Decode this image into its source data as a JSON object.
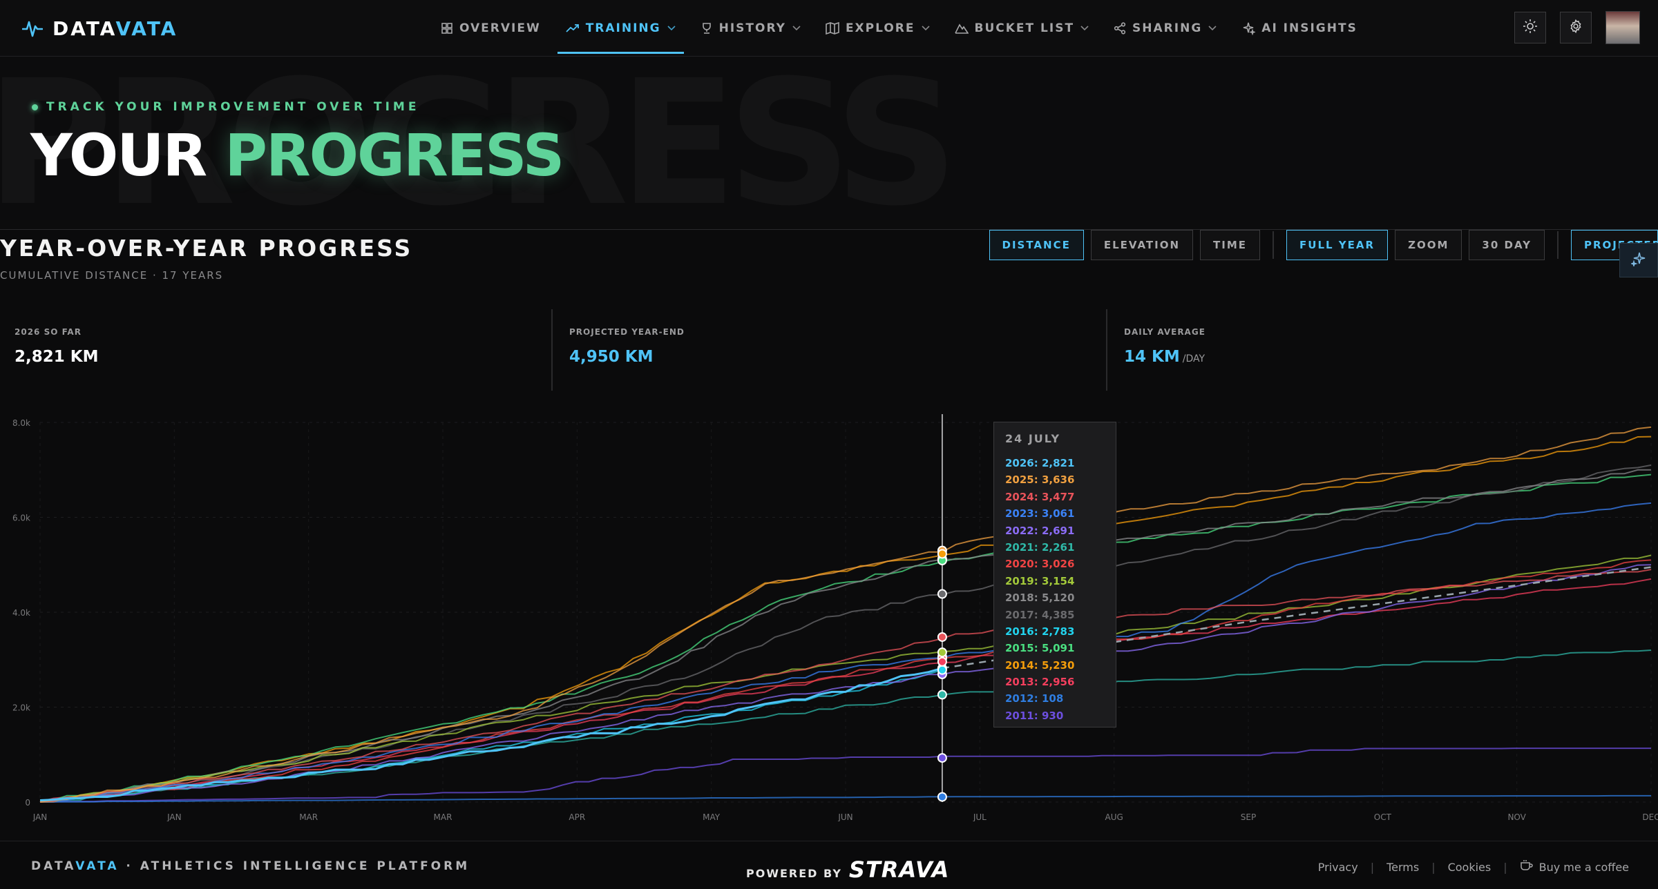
{
  "brand": {
    "name_a": "DATA",
    "name_b": "VATA"
  },
  "nav": {
    "items": [
      {
        "label": "OVERVIEW",
        "icon": "grid-icon",
        "chevron": false,
        "active": false
      },
      {
        "label": "TRAINING",
        "icon": "trend-icon",
        "chevron": true,
        "active": true
      },
      {
        "label": "HISTORY",
        "icon": "trophy-icon",
        "chevron": true,
        "active": false
      },
      {
        "label": "EXPLORE",
        "icon": "map-icon",
        "chevron": true,
        "active": false
      },
      {
        "label": "BUCKET LIST",
        "icon": "mountain-icon",
        "chevron": true,
        "active": false
      },
      {
        "label": "SHARING",
        "icon": "share-icon",
        "chevron": true,
        "active": false
      },
      {
        "label": "AI INSIGHTS",
        "icon": "sparkle-icon",
        "chevron": false,
        "active": false
      }
    ]
  },
  "hero": {
    "ghost": "PROGRESS",
    "kicker": "TRACK YOUR IMPROVEMENT OVER TIME",
    "title_a": "YOUR",
    "title_b": "PROGRESS"
  },
  "section": {
    "title": "YEAR-OVER-YEAR PROGRESS",
    "subtitle": "CUMULATIVE DISTANCE · 17 YEARS"
  },
  "toggles": {
    "metric": [
      "DISTANCE",
      "ELEVATION",
      "TIME"
    ],
    "range": [
      "FULL YEAR",
      "ZOOM",
      "30 DAY"
    ],
    "projection": "PROJECTED"
  },
  "stats": [
    {
      "label": "2026 SO FAR",
      "value": "2,821 KM",
      "unit": ""
    },
    {
      "label": "PROJECTED YEAR-END",
      "value": "4,950 KM",
      "unit": ""
    },
    {
      "label": "DAILY AVERAGE",
      "value": "14 KM",
      "unit": "/DAY"
    }
  ],
  "chart_data": {
    "type": "line",
    "title": "",
    "xlabel": "",
    "ylabel": "",
    "ylim": [
      0,
      8000
    ],
    "yticks": [
      "0",
      "2.0k",
      "4.0k",
      "6.0k",
      "8.0k"
    ],
    "xticks": [
      "JAN",
      "JAN",
      "MAR",
      "MAR",
      "APR",
      "MAY",
      "JUN",
      "JUL",
      "AUG",
      "SEP",
      "OCT",
      "NOV",
      "DEC"
    ],
    "grid": true,
    "cursor_x": 0.56,
    "tooltip_title": "24 JULY",
    "series": [
      {
        "name": "2026",
        "color": "#4fc3f7",
        "tooltip": "2026: 2,821",
        "points": [
          [
            0,
            0
          ],
          [
            0.1,
            350
          ],
          [
            0.2,
            700
          ],
          [
            0.3,
            1200
          ],
          [
            0.4,
            1700
          ],
          [
            0.5,
            2350
          ],
          [
            0.56,
            2821
          ]
        ],
        "width": 3
      },
      {
        "name": "2025",
        "color": "#f0a040",
        "tooltip": "2025: 3,636",
        "points": [
          [
            0,
            0
          ],
          [
            0.1,
            500
          ],
          [
            0.2,
            1200
          ],
          [
            0.3,
            1900
          ],
          [
            0.36,
            2800
          ],
          [
            0.45,
            4600
          ],
          [
            0.56,
            5300
          ],
          [
            0.62,
            5900
          ],
          [
            0.75,
            6500
          ],
          [
            0.9,
            7200
          ],
          [
            1,
            7900
          ]
        ],
        "width": 2
      },
      {
        "name": "2024",
        "color": "#e8535a",
        "tooltip": "2024: 3,477",
        "points": [
          [
            0,
            0
          ],
          [
            0.1,
            450
          ],
          [
            0.2,
            1000
          ],
          [
            0.3,
            1600
          ],
          [
            0.4,
            2300
          ],
          [
            0.5,
            3000
          ],
          [
            0.56,
            3477
          ],
          [
            0.7,
            4000
          ],
          [
            0.8,
            4300
          ],
          [
            1,
            4900
          ]
        ],
        "width": 2
      },
      {
        "name": "2023",
        "color": "#3b82f6",
        "tooltip": "2023: 3,061",
        "points": [
          [
            0,
            0
          ],
          [
            0.1,
            400
          ],
          [
            0.2,
            950
          ],
          [
            0.3,
            1500
          ],
          [
            0.4,
            2200
          ],
          [
            0.5,
            2800
          ],
          [
            0.56,
            3061
          ],
          [
            0.7,
            3600
          ],
          [
            0.78,
            5000
          ],
          [
            0.9,
            5900
          ],
          [
            1,
            6300
          ]
        ],
        "width": 2
      },
      {
        "name": "2022",
        "color": "#8b6cf6",
        "tooltip": "2022: 2,691",
        "points": [
          [
            0,
            0
          ],
          [
            0.1,
            300
          ],
          [
            0.2,
            750
          ],
          [
            0.3,
            1300
          ],
          [
            0.4,
            1900
          ],
          [
            0.5,
            2400
          ],
          [
            0.56,
            2691
          ],
          [
            0.7,
            3300
          ],
          [
            0.8,
            3900
          ],
          [
            1,
            5000
          ]
        ],
        "width": 2
      },
      {
        "name": "2021",
        "color": "#2fb8a8",
        "tooltip": "2021: 2,261",
        "points": [
          [
            0,
            0
          ],
          [
            0.1,
            300
          ],
          [
            0.2,
            700
          ],
          [
            0.3,
            1150
          ],
          [
            0.4,
            1600
          ],
          [
            0.5,
            2000
          ],
          [
            0.56,
            2261
          ],
          [
            0.62,
            2400
          ],
          [
            0.8,
            2800
          ],
          [
            1,
            3200
          ]
        ],
        "width": 2
      },
      {
        "name": "2020",
        "color": "#ef4444",
        "tooltip": "2020: 3,026",
        "points": [
          [
            0,
            0
          ],
          [
            0.1,
            350
          ],
          [
            0.2,
            850
          ],
          [
            0.3,
            1500
          ],
          [
            0.4,
            2100
          ],
          [
            0.5,
            2700
          ],
          [
            0.56,
            3026
          ],
          [
            0.7,
            3500
          ],
          [
            0.8,
            4200
          ],
          [
            1,
            5100
          ]
        ],
        "width": 2
      },
      {
        "name": "2019",
        "color": "#a3c93a",
        "tooltip": "2019: 3,154",
        "points": [
          [
            0,
            0
          ],
          [
            0.1,
            500
          ],
          [
            0.2,
            1100
          ],
          [
            0.3,
            1750
          ],
          [
            0.4,
            2400
          ],
          [
            0.5,
            2950
          ],
          [
            0.56,
            3154
          ],
          [
            0.7,
            3700
          ],
          [
            0.85,
            4400
          ],
          [
            1,
            5200
          ]
        ],
        "width": 2
      },
      {
        "name": "2018",
        "color": "#8a8a8c",
        "tooltip": "2018: 5,120",
        "points": [
          [
            0,
            0
          ],
          [
            0.1,
            500
          ],
          [
            0.2,
            1150
          ],
          [
            0.3,
            1900
          ],
          [
            0.38,
            2700
          ],
          [
            0.46,
            4200
          ],
          [
            0.56,
            5120
          ],
          [
            0.65,
            5400
          ],
          [
            0.8,
            6100
          ],
          [
            1,
            7000
          ]
        ],
        "width": 2
      },
      {
        "name": "2017",
        "color": "#6b6b6e",
        "tooltip": "2017: 4,385",
        "points": [
          [
            0,
            0
          ],
          [
            0.1,
            450
          ],
          [
            0.2,
            1100
          ],
          [
            0.3,
            1800
          ],
          [
            0.4,
            2600
          ],
          [
            0.48,
            3800
          ],
          [
            0.56,
            4385
          ],
          [
            0.7,
            5200
          ],
          [
            0.85,
            6200
          ],
          [
            1,
            7100
          ]
        ],
        "width": 2
      },
      {
        "name": "2016",
        "color": "#22d3ee",
        "tooltip": "2016: 2,783",
        "points": [
          [
            0,
            0
          ],
          [
            0.1,
            330
          ],
          [
            0.2,
            720
          ],
          [
            0.3,
            1250
          ],
          [
            0.4,
            1750
          ],
          [
            0.5,
            2300
          ],
          [
            0.56,
            2783
          ]
        ],
        "width": 2
      },
      {
        "name": "2015",
        "color": "#4ade80",
        "tooltip": "2015: 5,091",
        "points": [
          [
            0,
            0
          ],
          [
            0.1,
            550
          ],
          [
            0.2,
            1250
          ],
          [
            0.3,
            2000
          ],
          [
            0.38,
            2800
          ],
          [
            0.46,
            4300
          ],
          [
            0.56,
            5091
          ],
          [
            0.7,
            5600
          ],
          [
            0.85,
            6300
          ],
          [
            1,
            6900
          ]
        ],
        "width": 2
      },
      {
        "name": "2014",
        "color": "#f59e0b",
        "tooltip": "2014: 5,230",
        "points": [
          [
            0,
            0
          ],
          [
            0.1,
            550
          ],
          [
            0.2,
            1200
          ],
          [
            0.3,
            2000
          ],
          [
            0.36,
            2850
          ],
          [
            0.45,
            4600
          ],
          [
            0.56,
            5230
          ],
          [
            0.64,
            5700
          ],
          [
            0.8,
            6600
          ],
          [
            1,
            7700
          ]
        ],
        "width": 2
      },
      {
        "name": "2013",
        "color": "#f43f5e",
        "tooltip": "2013: 2,956",
        "points": [
          [
            0,
            0
          ],
          [
            0.1,
            400
          ],
          [
            0.2,
            900
          ],
          [
            0.3,
            1450
          ],
          [
            0.4,
            2050
          ],
          [
            0.5,
            2650
          ],
          [
            0.56,
            2956
          ],
          [
            0.7,
            3500
          ],
          [
            0.85,
            4100
          ],
          [
            1,
            4700
          ]
        ],
        "width": 2
      },
      {
        "name": "2012",
        "color": "#2f7de1",
        "tooltip": "2012: 108",
        "points": [
          [
            0,
            0
          ],
          [
            0.2,
            40
          ],
          [
            0.4,
            80
          ],
          [
            0.56,
            108
          ],
          [
            0.8,
            120
          ],
          [
            1,
            130
          ]
        ],
        "width": 2
      },
      {
        "name": "2011",
        "color": "#6d4fe0",
        "tooltip": "2011: 930",
        "points": [
          [
            0,
            0
          ],
          [
            0.2,
            100
          ],
          [
            0.3,
            220
          ],
          [
            0.43,
            880
          ],
          [
            0.56,
            930
          ],
          [
            0.75,
            950
          ],
          [
            0.78,
            1080
          ],
          [
            1,
            1100
          ]
        ],
        "width": 2
      }
    ],
    "projection": {
      "name": "projection",
      "color": "#9aa6ad",
      "points": [
        [
          0.56,
          2821
        ],
        [
          0.75,
          3800
        ],
        [
          1,
          4950
        ]
      ]
    }
  },
  "footer": {
    "left_a": "DATA",
    "left_b": "VATA",
    "left_c": " · ATHLETICS INTELLIGENCE PLATFORM",
    "powered_by": "POWERED BY",
    "strava": "STRAVA",
    "links": [
      "Privacy",
      "Terms",
      "Cookies"
    ],
    "coffee": "Buy me a coffee"
  }
}
